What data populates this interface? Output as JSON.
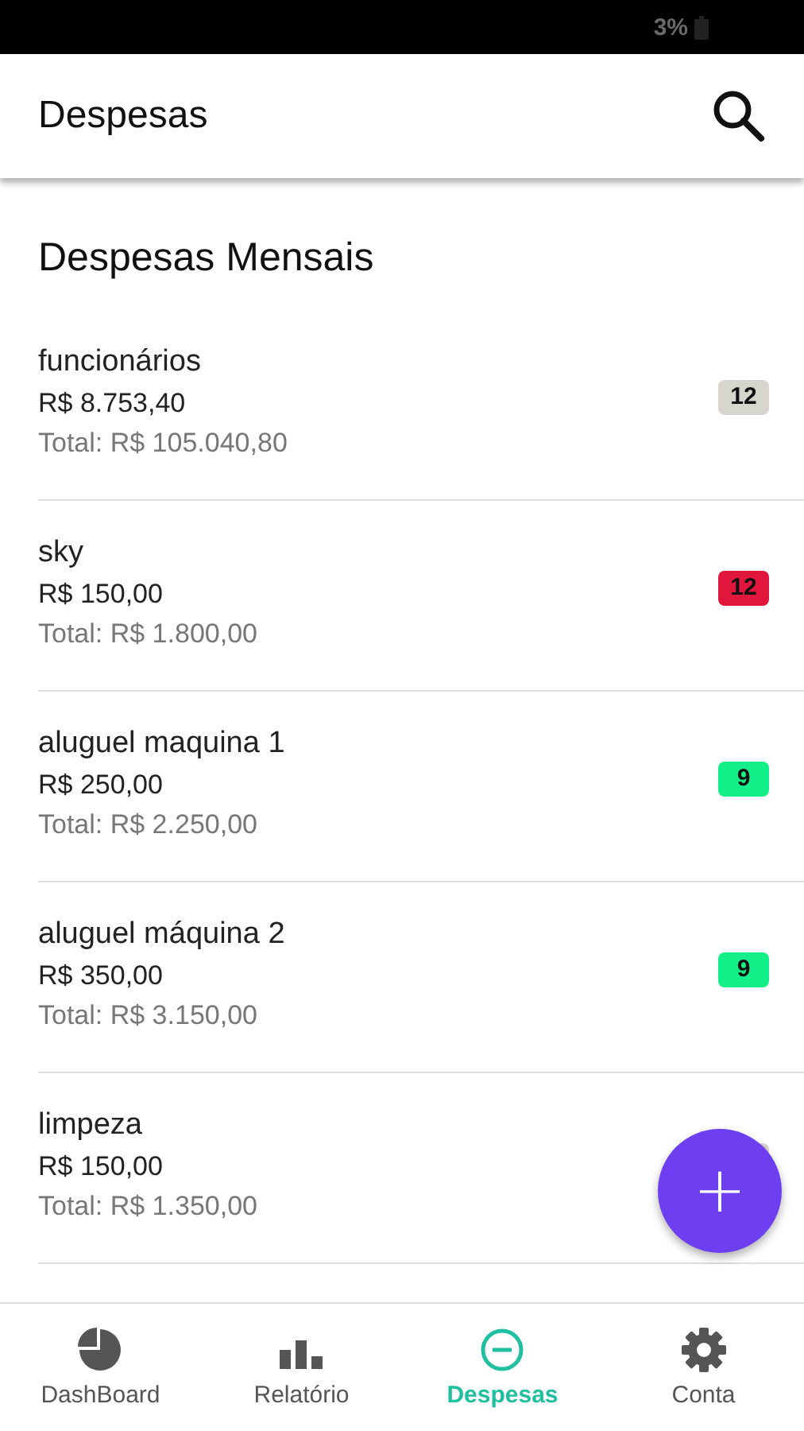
{
  "status_bar": {
    "battery": "3%"
  },
  "app_bar": {
    "title": "Despesas"
  },
  "section_title": "Despesas Mensais",
  "expenses": [
    {
      "name": "funcionários",
      "amount": "R$ 8.753,40",
      "total": "Total: R$ 105.040,80",
      "count": "12",
      "color": "#d6d6ce"
    },
    {
      "name": "sky",
      "amount": "R$ 150,00",
      "total": "Total: R$ 1.800,00",
      "count": "12",
      "color": "#e0163d"
    },
    {
      "name": "aluguel maquina 1",
      "amount": "R$ 250,00",
      "total": "Total: R$ 2.250,00",
      "count": "9",
      "color": "#13f08a"
    },
    {
      "name": "aluguel máquina 2",
      "amount": "R$ 350,00",
      "total": "Total: R$ 3.150,00",
      "count": "9",
      "color": "#13f08a"
    },
    {
      "name": "limpeza",
      "amount": "R$ 150,00",
      "total": "Total: R$ 1.350,00",
      "color": "#d6d6ce"
    }
  ],
  "fab": {
    "label": "+"
  },
  "nav": [
    {
      "label": "DashBoard",
      "kind": "pie",
      "selected": false
    },
    {
      "label": "Relatório",
      "kind": "bars",
      "selected": false
    },
    {
      "label": "Despesas",
      "kind": "minus",
      "selected": true
    },
    {
      "label": "Conta",
      "kind": "gear",
      "selected": false
    }
  ]
}
